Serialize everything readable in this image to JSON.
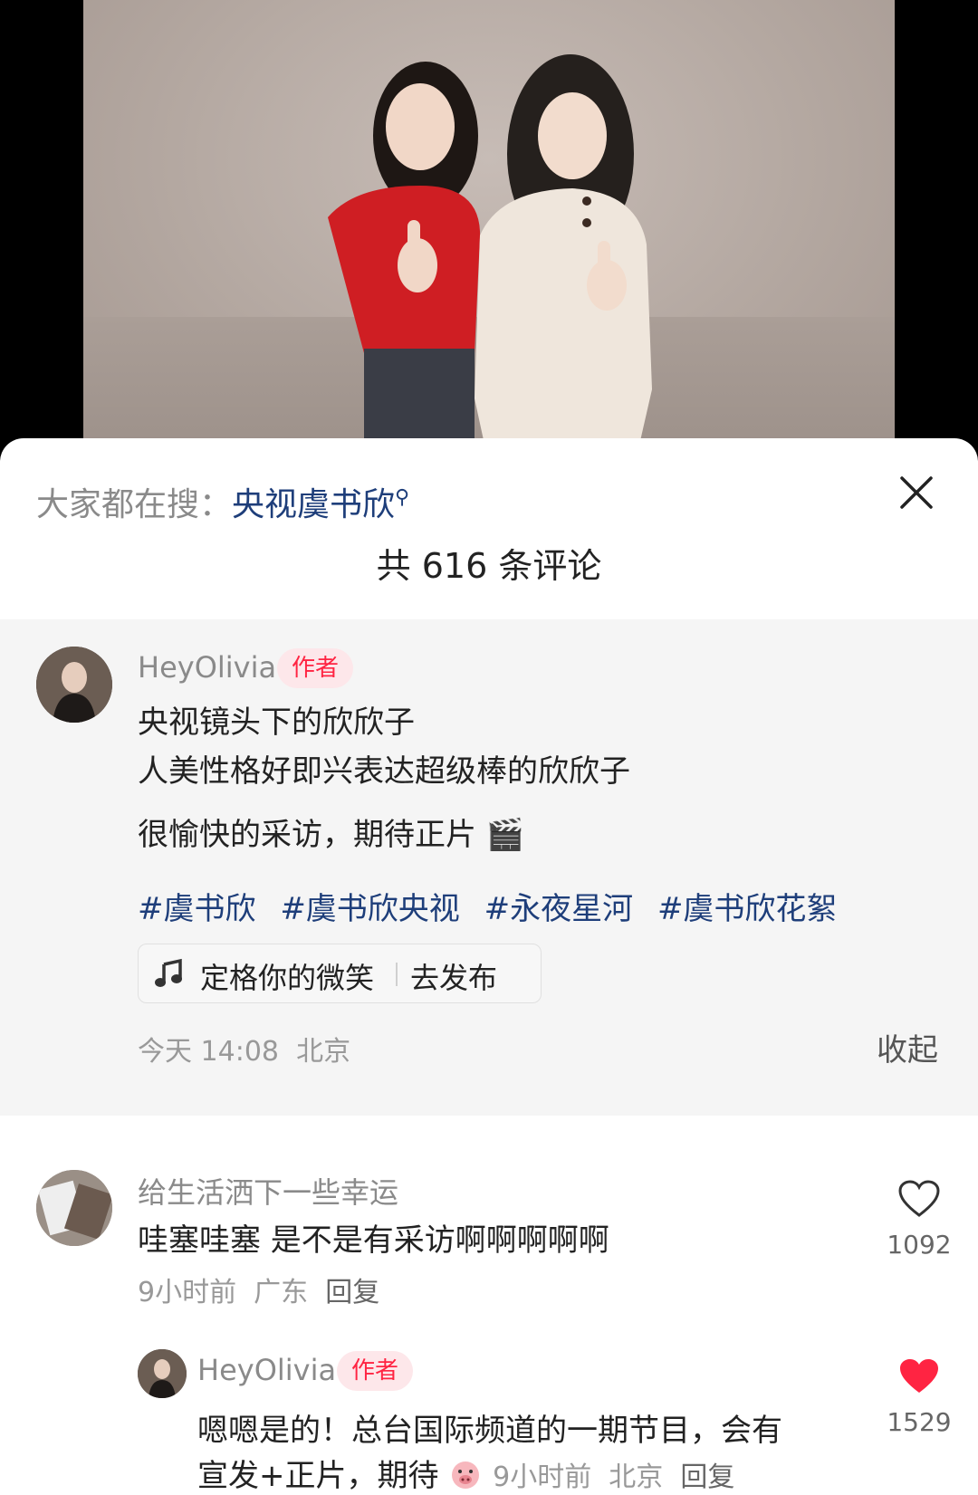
{
  "search_hint": {
    "prefix": "大家都在搜：",
    "keyword": "央视虞书欣"
  },
  "comments_total": "共 616 条评论",
  "author_comment": {
    "username": "HeyOlivia",
    "badge": "作者",
    "lines": [
      "央视镜头下的欣欣子",
      "人美性格好即兴表达超级棒的欣欣子",
      "很愉快的采访，期待正片 🎬"
    ],
    "hashtags": [
      "#虞书欣",
      "#虞书欣央视",
      "#永夜星河",
      "#虞书欣花絮"
    ],
    "music": {
      "title": "定格你的微笑",
      "action": "去发布",
      "icon": "music-note-icon"
    },
    "time": "今天 14:08",
    "location": "北京",
    "collapse_label": "收起"
  },
  "comment": {
    "username": "给生活洒下一些幸运",
    "text": "哇塞哇塞 是不是有采访啊啊啊啊啊",
    "time": "9小时前",
    "location": "广东",
    "reply_label": "回复",
    "likes": "1092",
    "liked": false
  },
  "reply": {
    "username": "HeyOlivia",
    "badge": "作者",
    "text_line1": "嗯嗯是的！总台国际频道的一期节目，会有",
    "text_line2": "宣发+正片，期待",
    "emoji": "pig-emoji-icon",
    "time": "9小时前",
    "location": "北京",
    "reply_label": "回复",
    "likes": "1529",
    "liked": true
  },
  "colors": {
    "accent_red": "#ff2442",
    "tag_blue": "#1e3e7a",
    "muted": "#999999"
  }
}
